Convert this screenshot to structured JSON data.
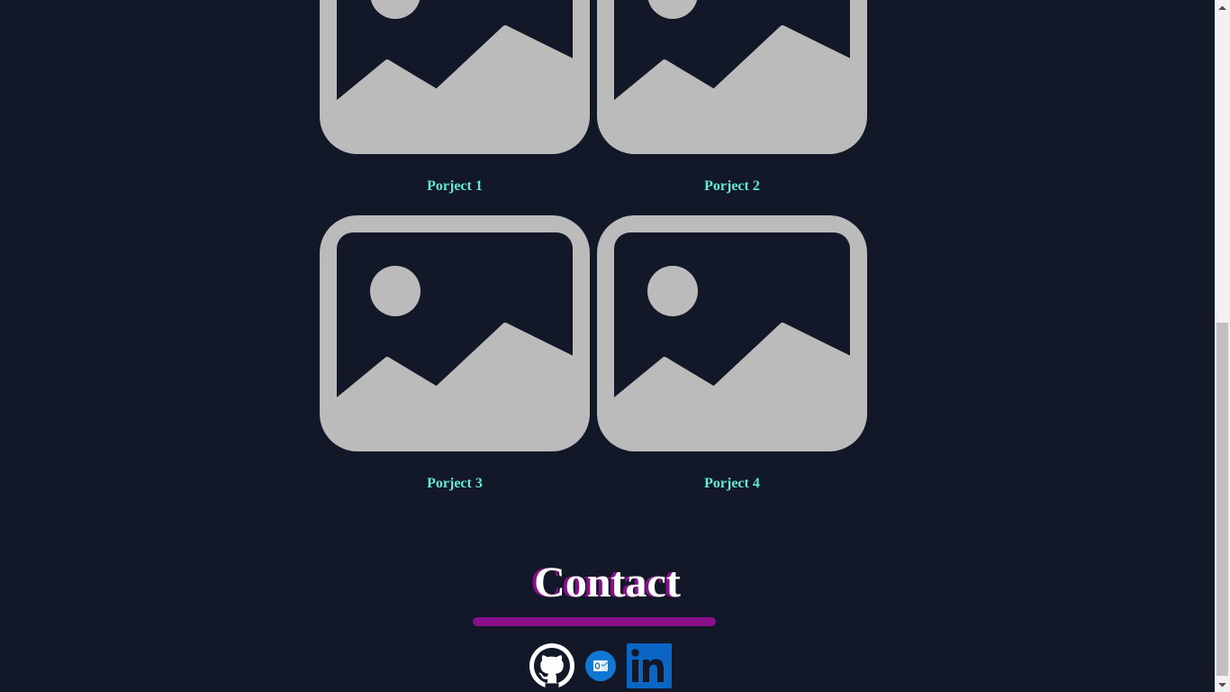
{
  "projects": [
    {
      "title": "Porject 1"
    },
    {
      "title": "Porject 2"
    },
    {
      "title": "Porject 3"
    },
    {
      "title": "Porject 4"
    }
  ],
  "contact": {
    "heading": "Contact"
  },
  "socials": [
    {
      "name": "github-icon"
    },
    {
      "name": "outlook-icon"
    },
    {
      "name": "linkedin-icon"
    }
  ],
  "colors": {
    "background": "#121828",
    "project_title": "#5eead4",
    "accent": "#8a0f8a",
    "placeholder_image": "#bbbbbb",
    "linkedin": "#0a66c2",
    "outlook": "#0f78d4"
  }
}
